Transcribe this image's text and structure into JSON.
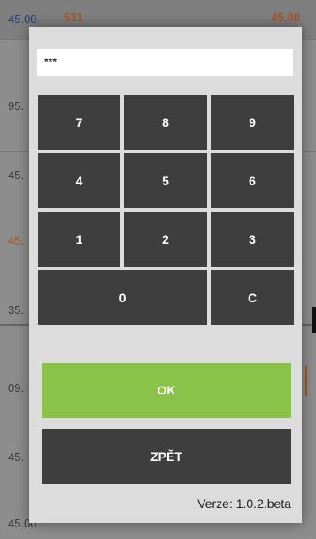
{
  "background": {
    "top_left": "45.00",
    "top_middle": "531",
    "top_right": "45.00",
    "row_values": [
      "95.",
      "45.",
      "45.",
      "35.",
      "09.",
      "45.",
      "45.00"
    ]
  },
  "dialog": {
    "pin_value": "***",
    "keys": {
      "k7": "7",
      "k8": "8",
      "k9": "9",
      "k4": "4",
      "k5": "5",
      "k6": "6",
      "k1": "1",
      "k2": "2",
      "k3": "3",
      "k0": "0",
      "clear": "C"
    },
    "ok_label": "OK",
    "back_label": "ZPĚT",
    "version": "Verze: 1.0.2.beta"
  },
  "colors": {
    "accent_ok": "#8bc34a",
    "key_bg": "#3e3e3e",
    "dialog_bg": "#dcdcdc"
  }
}
